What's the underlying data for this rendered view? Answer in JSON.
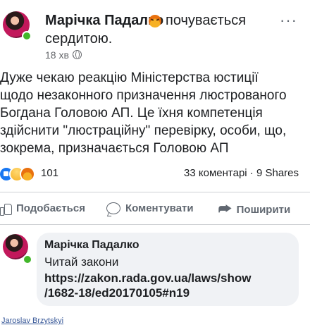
{
  "post": {
    "author": "Марічка Падалко",
    "feeling_emoji": "angry-face-emoji",
    "feeling_line1": "почувається",
    "feeling_line2": "сердитою.",
    "time": "18 хв",
    "separator": "·",
    "privacy_icon": "globe-icon",
    "more_icon": "···",
    "text_lines": [
      "Дуже чекаю реакцію Міністерства юстиції",
      "щодо незаконного призначення люстрованого",
      "Богдана Головою АП. Це їхня компетенція",
      "здійснити \"люстраційну\" перевірку, особи, що,",
      "зокрема, призначається Головою АП"
    ]
  },
  "reactions": {
    "icons": [
      "like",
      "haha",
      "angry"
    ],
    "count": "101",
    "comments_shares": "33 коментарі · 9 Shares"
  },
  "actions": {
    "like": "Подобається",
    "comment": "Коментувати",
    "share": "Поширити"
  },
  "comment": {
    "author": "Марічка Падалко",
    "text": "Читай закони",
    "link_line1": "https://zakon.rada.gov.ua/laws/show",
    "link_line2": "/1682-18/ed20170105#n19"
  },
  "next_comment_name": "Jaroslav Brzytskyi",
  "colors": {
    "text": "#1c1e21",
    "secondary": "#65676b",
    "bubble": "#f0f2f5",
    "online": "#42b72a",
    "like_blue": "#1877f2"
  }
}
